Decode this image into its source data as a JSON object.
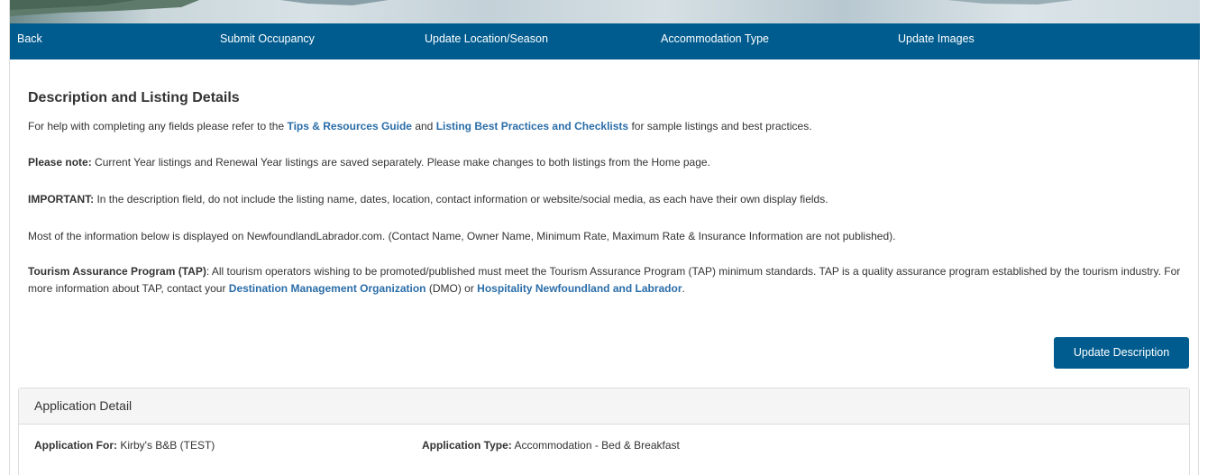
{
  "nav": {
    "back": "Back",
    "submit_occupancy": "Submit Occupancy",
    "update_location": "Update Location/Season",
    "accommodation_type": "Accommodation Type",
    "update_images": "Update Images"
  },
  "heading": "Description and Listing Details",
  "help": {
    "pre": "For help with completing any fields please refer to the ",
    "link1": "Tips & Resources Guide",
    "mid": " and ",
    "link2": "Listing Best Practices and Checklists",
    "post": " for sample listings and best practices."
  },
  "note": {
    "label": "Please note:",
    "text": " Current Year listings and Renewal Year listings are saved separately. Please make changes to both listings from the Home page."
  },
  "important": {
    "label": "IMPORTANT:",
    "text": " In the description field, do not include the listing name, dates, location, contact information or website/social media, as each have their own display fields."
  },
  "info": "Most of the information below is displayed on NewfoundlandLabrador.com. (Contact Name, Owner Name, Minimum Rate, Maximum Rate & Insurance Information are not published).",
  "tap": {
    "label": "Tourism Assurance Program (TAP)",
    "text1": ": All tourism operators wishing to be promoted/published must meet the Tourism Assurance Program (TAP) minimum standards. TAP is a quality assurance program established by the tourism industry. For more information about TAP, contact your ",
    "link1": "Destination Management Organization",
    "text2": " (DMO) or ",
    "link2": "Hospitality Newfoundland and Labrador",
    "text3": "."
  },
  "update_button": "Update Description",
  "application": {
    "title": "Application Detail",
    "for_label": "Application For:",
    "for_value": " Kirby's B&B (TEST)",
    "type_label": "Application Type:",
    "type_value": " Accommodation - Bed & Breakfast"
  },
  "colors": {
    "nav_bg": "#005c8f",
    "link": "#2a6da8",
    "highlight": "#d9231d"
  }
}
